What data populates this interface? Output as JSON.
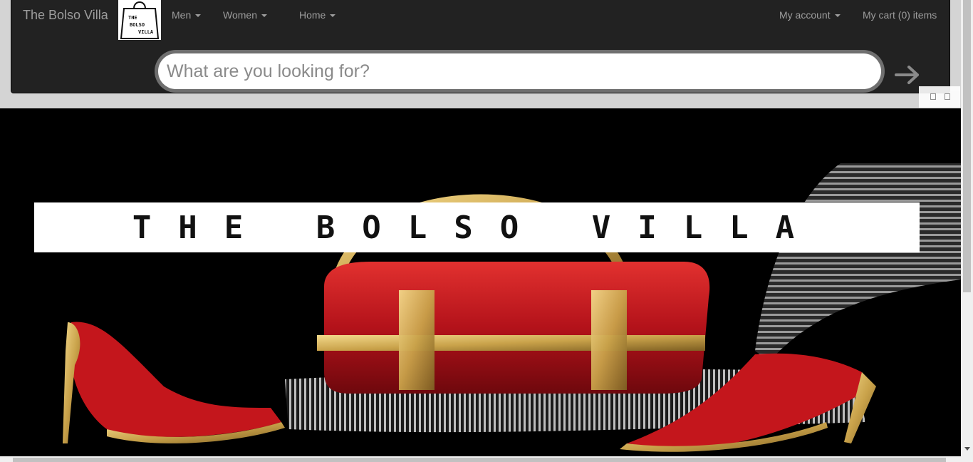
{
  "brand": {
    "name": "The Bolso Villa"
  },
  "logo": {
    "line1": "THE",
    "line2": "BOLSO",
    "line3": "VILLA"
  },
  "nav": {
    "men": "Men",
    "women": "Women",
    "home": "Home",
    "account": "My account",
    "cart": "My cart (0) items"
  },
  "search": {
    "placeholder": "What are you looking for?",
    "value": ""
  },
  "hero": {
    "banner_text": "THE BOLSO VILLA"
  },
  "colors": {
    "navbar": "#222222",
    "nav_text": "#9d9d9d",
    "hero_bg": "#000000",
    "bag_red": "#c4161c",
    "gold": "#c9a24a"
  }
}
